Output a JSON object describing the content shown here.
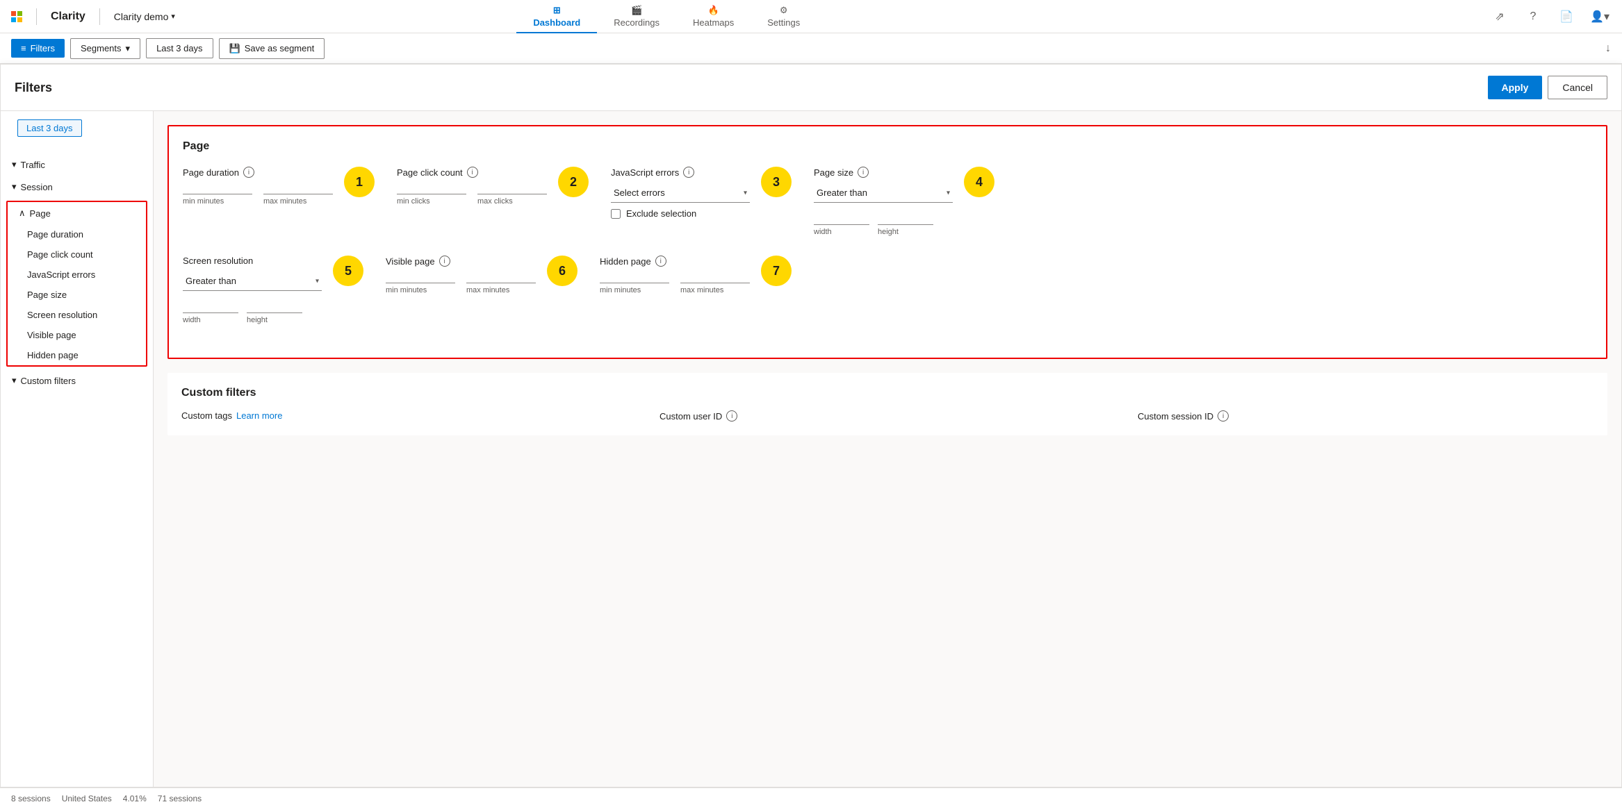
{
  "topbar": {
    "brand": "Clarity",
    "divider": true,
    "project_name": "Clarity demo",
    "nav_items": [
      {
        "id": "dashboard",
        "label": "Dashboard",
        "icon": "⊞",
        "active": true
      },
      {
        "id": "recordings",
        "label": "Recordings",
        "icon": "🎬",
        "active": false
      },
      {
        "id": "heatmaps",
        "label": "Heatmaps",
        "icon": "🔥",
        "active": false
      },
      {
        "id": "settings",
        "label": "Settings",
        "icon": "⚙",
        "active": false
      }
    ],
    "right_icons": [
      "share",
      "help",
      "docs",
      "account"
    ]
  },
  "subtoolbar": {
    "filters_label": "Filters",
    "segments_label": "Segments",
    "date_label": "Last 3 days",
    "save_label": "Save as segment"
  },
  "filter_panel": {
    "title": "Filters",
    "apply_label": "Apply",
    "cancel_label": "Cancel",
    "sidebar": {
      "date_btn": "Last 3 days",
      "sections": [
        {
          "id": "traffic",
          "label": "Traffic",
          "expanded": false
        },
        {
          "id": "session",
          "label": "Session",
          "expanded": false
        },
        {
          "id": "page",
          "label": "Page",
          "expanded": true,
          "highlighted": true,
          "items": [
            "Page duration",
            "Page click count",
            "JavaScript errors",
            "Page size",
            "Screen resolution",
            "Visible page",
            "Hidden page"
          ]
        },
        {
          "id": "custom_filters",
          "label": "Custom filters",
          "expanded": false
        }
      ]
    },
    "page_section": {
      "title": "Page",
      "highlighted": true,
      "rows": [
        {
          "groups": [
            {
              "id": "page_duration",
              "label": "Page duration",
              "has_info": true,
              "badge": "1",
              "type": "min_max",
              "min_placeholder": "",
              "max_placeholder": "",
              "min_label": "min minutes",
              "max_label": "max minutes"
            },
            {
              "id": "page_click_count",
              "label": "Page click count",
              "has_info": true,
              "badge": "2",
              "type": "min_max",
              "min_placeholder": "",
              "max_placeholder": "",
              "min_label": "min clicks",
              "max_label": "max clicks"
            },
            {
              "id": "javascript_errors",
              "label": "JavaScript errors",
              "has_info": true,
              "badge": "3",
              "type": "dropdown_with_checkbox",
              "dropdown_placeholder": "Select errors",
              "checkbox_label": "Exclude selection"
            },
            {
              "id": "page_size",
              "label": "Page size",
              "has_info": true,
              "badge": "4",
              "type": "dropdown_with_wh",
              "dropdown_value": "Greater than",
              "width_label": "width",
              "height_label": "height"
            }
          ]
        },
        {
          "groups": [
            {
              "id": "screen_resolution",
              "label": "Screen resolution",
              "has_info": false,
              "badge": "5",
              "type": "dropdown_with_wh",
              "dropdown_value": "Greater than",
              "width_label": "width",
              "height_label": "height"
            },
            {
              "id": "visible_page",
              "label": "Visible page",
              "has_info": true,
              "badge": "6",
              "type": "min_max",
              "min_placeholder": "",
              "max_placeholder": "",
              "min_label": "min minutes",
              "max_label": "max minutes"
            },
            {
              "id": "hidden_page",
              "label": "Hidden page",
              "has_info": true,
              "badge": "7",
              "type": "min_max",
              "min_placeholder": "",
              "max_placeholder": "",
              "min_label": "min minutes",
              "max_label": "max minutes"
            }
          ]
        }
      ]
    },
    "custom_section": {
      "title": "Custom filters",
      "groups": [
        {
          "id": "custom_tags",
          "label": "Custom tags",
          "has_info": false,
          "link_label": "Learn more",
          "link_url": "#"
        },
        {
          "id": "custom_user_id",
          "label": "Custom user ID",
          "has_info": true
        },
        {
          "id": "custom_session_id",
          "label": "Custom session ID",
          "has_info": true
        }
      ]
    }
  },
  "bottom_bar": {
    "sessions_label": "8 sessions",
    "country": "United States",
    "percentage": "4.01%",
    "sessions_count": "71 sessions"
  },
  "icons": {
    "chevron_down": "▾",
    "chevron_right": "›",
    "info": "i",
    "filter_lines": "≡",
    "share": "⇗",
    "help": "?",
    "docs": "📄",
    "save_disk": "💾",
    "download": "↓",
    "dropdown_arrow": "▾"
  }
}
